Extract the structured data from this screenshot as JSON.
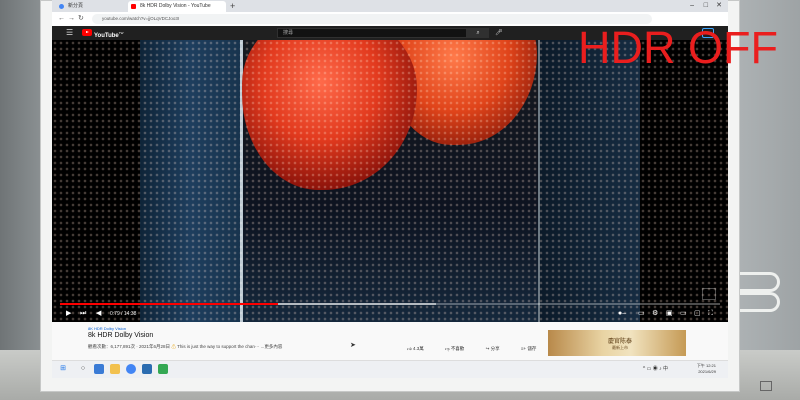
{
  "overlay_text": "HDR OFF",
  "browser": {
    "tabs": [
      {
        "label": "新分頁",
        "icon": "chrome-icon",
        "active": false
      },
      {
        "label": "8k HDR Dolby Vision - YouTube",
        "icon": "youtube-icon",
        "active": true
      }
    ],
    "new_tab": "+",
    "url": "youtube.com/watch?v=jjOLqVDCJoo3I"
  },
  "youtube": {
    "logo": "YouTube",
    "logo_badge": "TW",
    "search_placeholder": "搜尋",
    "time": "0:79 / 14:38",
    "progress_fraction": 0.33,
    "buffered_fraction": 0.57,
    "channel_tag": "8K HDR Dolby Vision",
    "title": "8k HDR Dolby Vision",
    "meta": "觀看次數：6,177,891次 · 2021年6月28日",
    "notice": "This is just the way to support the chan··· ...更多內容",
    "actions": [
      "4.3萬",
      "不喜歡",
      "分享",
      "儲存"
    ],
    "ad_title": "慶官陈泰",
    "ad_subtitle": "最新上市"
  },
  "taskbar": {
    "clock_time": "下午 12:21",
    "clock_date": "2021/6/29"
  },
  "colors": {
    "overlay": "#ea1e1e",
    "youtube_red": "#ff0000",
    "player_bg": "#000000"
  }
}
